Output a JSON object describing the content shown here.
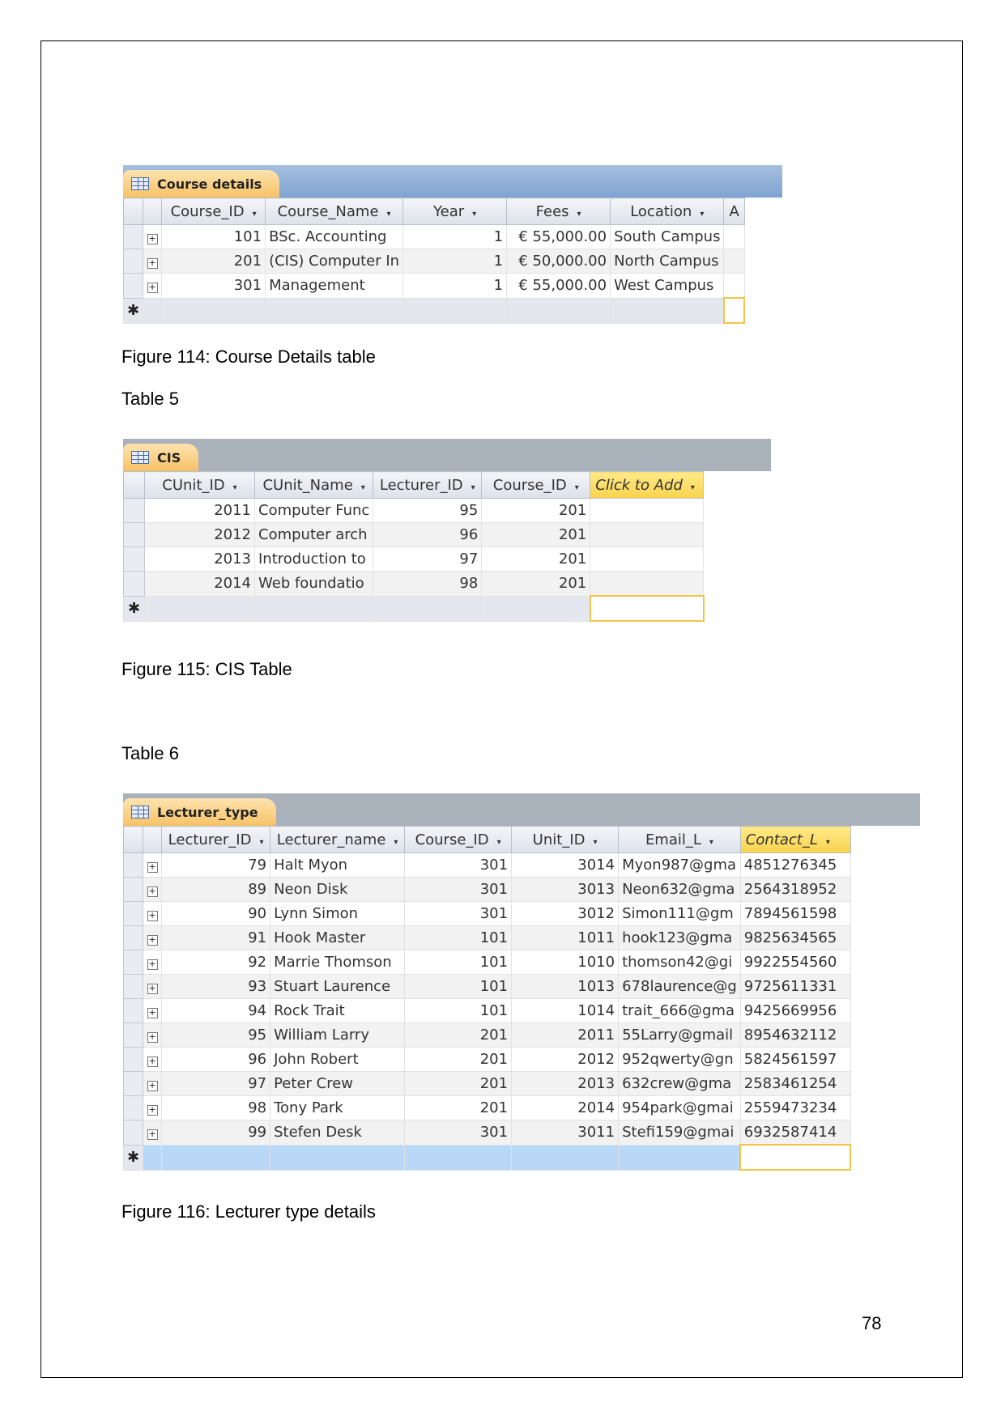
{
  "course_table": {
    "tab_label": "Course details",
    "columns": [
      "Course_ID",
      "Course_Name",
      "Year",
      "Fees",
      "Location",
      "A"
    ],
    "rows": [
      [
        "101",
        "BSc. Accounting",
        "1",
        "€ 55,000.00",
        "South Campus"
      ],
      [
        "201",
        "(CIS) Computer In",
        "1",
        "€ 50,000.00",
        "North Campus"
      ],
      [
        "301",
        "Management",
        "1",
        "€ 55,000.00",
        "West Campus"
      ]
    ],
    "new_row_marker": "✱",
    "caption": "Figure 114: Course Details table"
  },
  "table5_label": "Table 5",
  "cis_table": {
    "tab_label": "CIS",
    "columns": [
      "CUnit_ID",
      "CUnit_Name",
      "Lecturer_ID",
      "Course_ID",
      "Click to Add"
    ],
    "rows": [
      [
        "2011",
        "Computer Func",
        "95",
        "201"
      ],
      [
        "2012",
        "Computer arch",
        "96",
        "201"
      ],
      [
        "2013",
        "Introduction to",
        "97",
        "201"
      ],
      [
        "2014",
        "Web foundatio",
        "98",
        "201"
      ]
    ],
    "new_row_marker": "✱",
    "caption": "Figure 115: CIS Table"
  },
  "table6_label": "Table 6",
  "lecturer_table": {
    "tab_label": "Lecturer_type",
    "columns": [
      "Lecturer_ID",
      "Lecturer_name",
      "Course_ID",
      "Unit_ID",
      "Email_L",
      "Contact_L"
    ],
    "rows": [
      [
        "79",
        "Halt Myon",
        "301",
        "3014",
        "Myon987@gma",
        "4851276345"
      ],
      [
        "89",
        "Neon Disk",
        "301",
        "3013",
        "Neon632@gma",
        "2564318952"
      ],
      [
        "90",
        "Lynn Simon",
        "301",
        "3012",
        "Simon111@gm",
        "7894561598"
      ],
      [
        "91",
        "Hook Master",
        "101",
        "1011",
        "hook123@gma",
        "9825634565"
      ],
      [
        "92",
        "Marrie Thomson",
        "101",
        "1010",
        "thomson42@gi",
        "9922554560"
      ],
      [
        "93",
        "Stuart Laurence",
        "101",
        "1013",
        "678laurence@g",
        "9725611331"
      ],
      [
        "94",
        "Rock Trait",
        "101",
        "1014",
        "trait_666@gma",
        "9425669956"
      ],
      [
        "95",
        "William Larry",
        "201",
        "2011",
        "55Larry@gmail",
        "8954632112"
      ],
      [
        "96",
        "John Robert",
        "201",
        "2012",
        "952qwerty@gn",
        "5824561597"
      ],
      [
        "97",
        "Peter Crew",
        "201",
        "2013",
        "632crew@gma",
        "2583461254"
      ],
      [
        "98",
        "Tony Park",
        "201",
        "2014",
        "954park@gmai",
        "2559473234"
      ],
      [
        "99",
        "Stefen Desk",
        "301",
        "3011",
        "Stefi159@gmai",
        "6932587414"
      ]
    ],
    "new_row_marker": "✱",
    "caption": "Figure 116: Lecturer type details"
  },
  "page_number": "78",
  "icons": {
    "table": "datasheet-table-icon",
    "expand": "plus",
    "dropdown": "▾"
  }
}
